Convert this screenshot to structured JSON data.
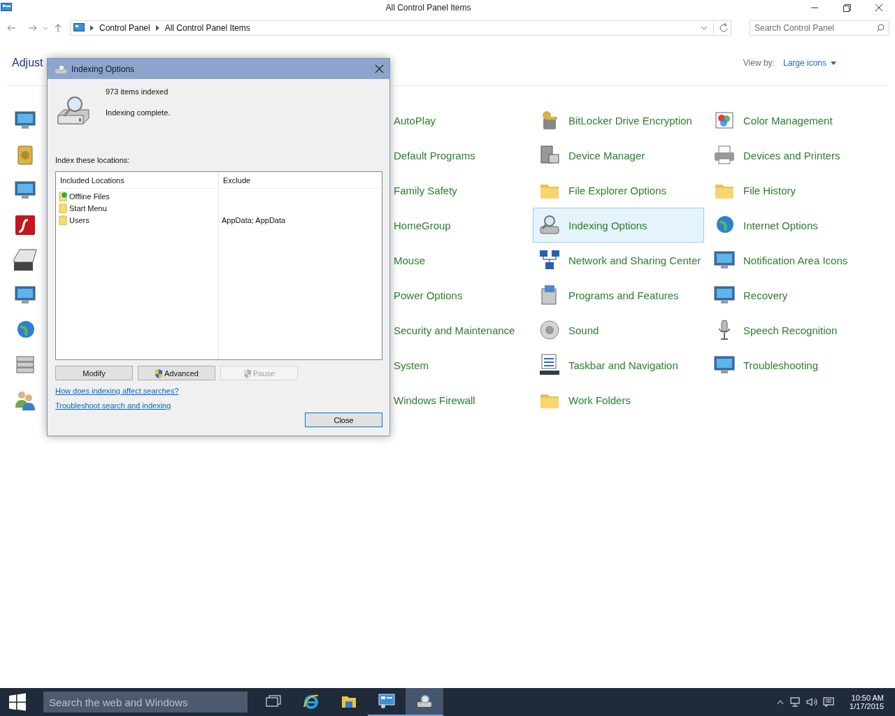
{
  "window": {
    "title": "All Control Panel Items"
  },
  "address_bar": {
    "breadcrumbs": [
      "Control Panel",
      "All Control Panel Items"
    ]
  },
  "search": {
    "placeholder": "Search Control Panel"
  },
  "heading": "Adjust",
  "view_by": {
    "label": "View by:",
    "value": "Large icons"
  },
  "items": [
    {
      "label": "AutoPlay",
      "selected": false
    },
    {
      "label": "BitLocker Drive Encryption",
      "selected": false
    },
    {
      "label": "Color Management",
      "selected": false
    },
    {
      "label": "Default Programs",
      "selected": false
    },
    {
      "label": "Device Manager",
      "selected": false
    },
    {
      "label": "Devices and Printers",
      "selected": false
    },
    {
      "label": "Family Safety",
      "selected": false
    },
    {
      "label": "File Explorer Options",
      "selected": false
    },
    {
      "label": "File History",
      "selected": false
    },
    {
      "label": "HomeGroup",
      "selected": false
    },
    {
      "label": "Indexing Options",
      "selected": true
    },
    {
      "label": "Internet Options",
      "selected": false
    },
    {
      "label": "Mouse",
      "selected": false
    },
    {
      "label": "Network and Sharing Center",
      "selected": false
    },
    {
      "label": "Notification Area Icons",
      "selected": false
    },
    {
      "label": "Power Options",
      "selected": false
    },
    {
      "label": "Programs and Features",
      "selected": false
    },
    {
      "label": "Recovery",
      "selected": false
    },
    {
      "label": "Security and Maintenance",
      "selected": false
    },
    {
      "label": "Sound",
      "selected": false
    },
    {
      "label": "Speech Recognition",
      "selected": false
    },
    {
      "label": "System",
      "selected": false
    },
    {
      "label": "Taskbar and Navigation",
      "selected": false
    },
    {
      "label": "Troubleshooting",
      "selected": false
    },
    {
      "label": "Windows Firewall",
      "selected": false
    },
    {
      "label": "Work Folders",
      "selected": false
    }
  ],
  "dialog": {
    "title": "Indexing Options",
    "count": "973 items indexed",
    "status": "Indexing complete.",
    "locations_label": "Index these locations:",
    "columns": [
      "Included Locations",
      "Exclude"
    ],
    "rows": [
      {
        "location": "Offline Files",
        "kind": "sync"
      },
      {
        "location": "Start Menu",
        "kind": "folder"
      },
      {
        "location": "Users",
        "kind": "folder",
        "exclude": "AppData; AppData"
      }
    ],
    "buttons": [
      {
        "label": "Modify",
        "shield": false,
        "disabled": false
      },
      {
        "label": "Advanced",
        "shield": true,
        "disabled": false
      },
      {
        "label": "Pause",
        "shield": true,
        "disabled": true
      }
    ],
    "links": [
      "How does indexing affect searches?",
      "Troubleshoot search and indexing"
    ],
    "close_button": "Close"
  },
  "taskbar": {
    "search_placeholder": "Search the web and Windows",
    "apps": [
      {
        "kind": "task-view",
        "running": false,
        "selected": false
      },
      {
        "kind": "browser",
        "running": false,
        "selected": false
      },
      {
        "kind": "folder",
        "running": false,
        "selected": false
      },
      {
        "kind": "control-panel",
        "running": true,
        "selected": false
      },
      {
        "kind": "indexing",
        "running": true,
        "selected": true
      }
    ],
    "time": "10:50 AM",
    "date": "1/17/2015"
  }
}
